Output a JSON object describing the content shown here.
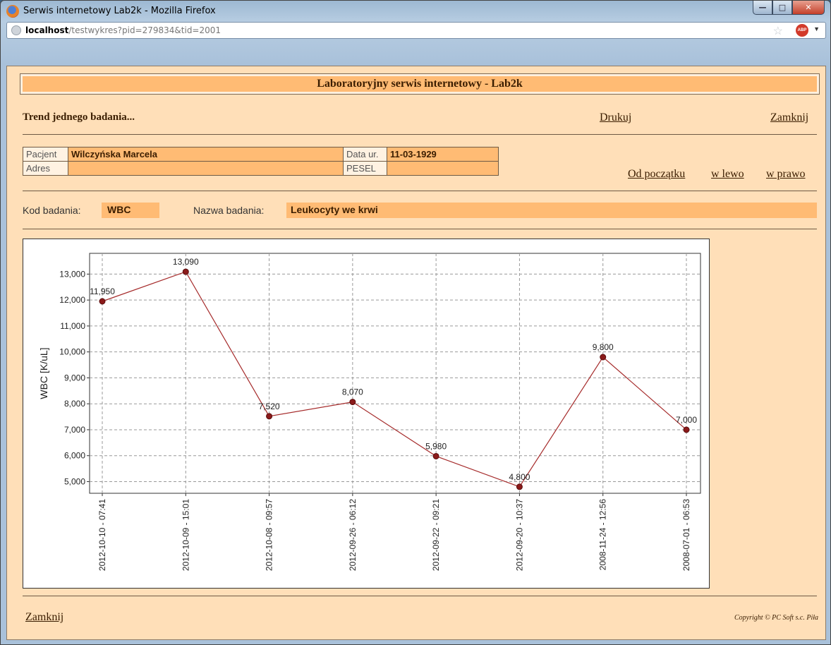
{
  "window": {
    "title": "Serwis internetowy Lab2k - Mozilla Firefox",
    "url_host": "localhost",
    "url_path": "/testwykres?pid=279834&tid=2001",
    "minimize_glyph": "—",
    "maximize_glyph": "□",
    "close_glyph": "✕",
    "star_glyph": "☆",
    "abp_text": "ABP",
    "abp_arrow": "▼"
  },
  "page": {
    "banner": "Laboratoryjny serwis internetowy - Lab2k",
    "subtitle": "Trend jednego badania...",
    "print_link": "Drukuj",
    "close_link": "Zamknij",
    "nav": {
      "from_start": "Od początku",
      "left": "w lewo",
      "right": "w prawo"
    },
    "patient": {
      "name_label": "Pacjent",
      "name": "Wilczyńska Marcela",
      "dob_label": "Data ur.",
      "dob": "11-03-1929",
      "address_label": "Adres",
      "address": "",
      "pesel_label": "PESEL",
      "pesel": ""
    },
    "test": {
      "code_label": "Kod badania:",
      "code": "WBC",
      "name_label": "Nazwa badania:",
      "name": "Leukocyty we krwi"
    },
    "footer_close": "Zamknij",
    "copyright": "Copyright © PC Soft s.c. Piła"
  },
  "chart_data": {
    "type": "line",
    "title": "",
    "xlabel": "",
    "ylabel": "WBC [K/uL]",
    "categories": [
      "2012-10-10 - 07:41",
      "2012-10-09 - 15:01",
      "2012-10-08 - 09:57",
      "2012-09-26 - 06:12",
      "2012-09-22 - 09:21",
      "2012-09-20 - 10:37",
      "2008-11-24 - 12:56",
      "2008-07-01 - 06:53"
    ],
    "values": [
      11950,
      13090,
      7520,
      8070,
      5980,
      4800,
      9800,
      7000
    ],
    "value_labels": [
      "11,950",
      "13,090",
      "7,520",
      "8,070",
      "5,980",
      "4,800",
      "9,800",
      "7,000"
    ],
    "ylim": [
      4550,
      13800
    ],
    "yticks": [
      5000,
      6000,
      7000,
      8000,
      9000,
      10000,
      11000,
      12000,
      13000
    ],
    "ytick_labels": [
      "5,000",
      "6,000",
      "7,000",
      "8,000",
      "9,000",
      "10,000",
      "11,000",
      "12,000",
      "13,000"
    ],
    "grid": true,
    "line_color": "#a52a2a",
    "marker_color": "#8b1a1a"
  }
}
